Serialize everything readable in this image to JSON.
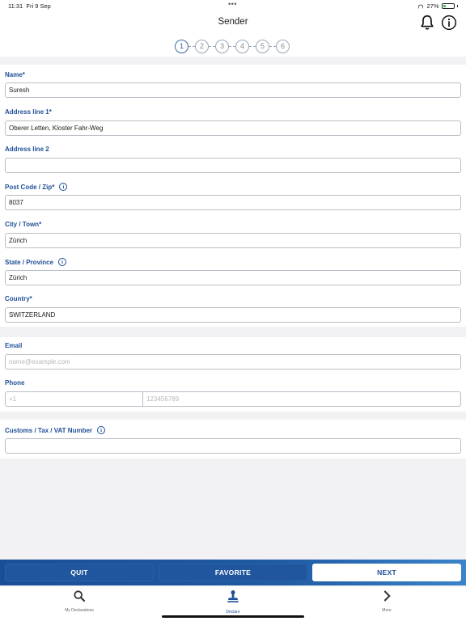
{
  "status": {
    "time": "11:31",
    "date": "Fri 9 Sep",
    "battery": "27%"
  },
  "header": {
    "title": "Sender"
  },
  "stepper": {
    "steps": [
      "1",
      "2",
      "3",
      "4",
      "5",
      "6"
    ],
    "current": 1
  },
  "form": {
    "name": {
      "label": "Name*",
      "value": "Suresh"
    },
    "address1": {
      "label": "Address line 1*",
      "value": "Oberer Letten, Kloster Fahr-Weg"
    },
    "address2": {
      "label": "Address line 2",
      "value": ""
    },
    "postcode": {
      "label": "Post Code / Zip*",
      "value": "8037"
    },
    "city": {
      "label": "City / Town*",
      "value": "Zürich"
    },
    "state": {
      "label": "State / Province",
      "value": "Zürich"
    },
    "country": {
      "label": "Country*",
      "value": "SWITZERLAND"
    },
    "email": {
      "label": "Email",
      "placeholder": "name@example.com"
    },
    "phone": {
      "label": "Phone",
      "code_placeholder": "+1",
      "number_placeholder": "123456789"
    },
    "customs": {
      "label": "Customs / Tax / VAT Number",
      "value": ""
    }
  },
  "actions": {
    "quit": "QUIT",
    "favorite": "FAVORITE",
    "next": "NEXT"
  },
  "tabs": [
    {
      "label": "My Declarations",
      "icon": "search-icon"
    },
    {
      "label": "Declare",
      "icon": "stamp-icon"
    },
    {
      "label": "More",
      "icon": "chevron-right-icon"
    }
  ],
  "colors": {
    "accent": "#1e4f96",
    "action_bar": "#1f5aa3",
    "background": "#f2f2f4"
  }
}
